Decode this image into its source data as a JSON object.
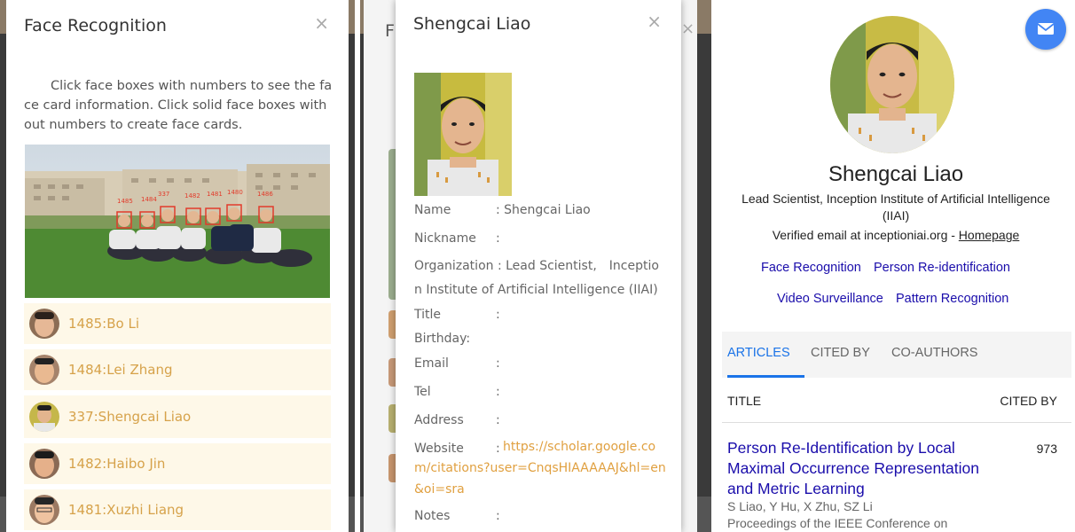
{
  "panel1": {
    "title": "Face Recognition",
    "close": "×",
    "instructions": "Click face boxes with numbers to see the face card information. Click solid face boxes without numbers to create face cards.",
    "faces": [
      {
        "label": "1485:Bo Li"
      },
      {
        "label": "1484:Lei Zhang"
      },
      {
        "label": "337:Shengcai Liao"
      },
      {
        "label": "1482:Haibo Jin"
      },
      {
        "label": "1481:Xuzhi Liang"
      }
    ]
  },
  "panel2": {
    "behind_title_letter": "F",
    "behind_close": "×",
    "title": "Shengcai Liao",
    "close": "×",
    "fields": {
      "name_label": "Name",
      "name_value": ": Shengcai Liao",
      "nickname_label": "Nickname",
      "nickname_value": ":",
      "org_text": "Organization : Lead Scientist,　Inception Institute of Artificial Intelligence (IIAI)",
      "title_label": "Title",
      "title_value": ":",
      "birthday_label": "Birthday:",
      "email_label": "Email",
      "email_value": ":",
      "tel_label": "Tel",
      "tel_value": ":",
      "address_label": "Address",
      "address_value": ":",
      "website_label": "Website",
      "website_colon": ":",
      "website_url": "https://scholar.google.com/citations?user=CnqsHIAAAAAJ&hl=en&oi=sra",
      "notes_label": "Notes",
      "notes_value": ":"
    }
  },
  "panel3": {
    "name": "Shengcai Liao",
    "affiliation": "Lead Scientist, Inception Institute of Artificial Intelligence (IIAI)",
    "email_text": "Verified email at inceptioniai.org - ",
    "homepage": "Homepage",
    "interests": [
      "Face Recognition",
      "Person Re-identification",
      "Video Surveillance",
      "Pattern Recognition"
    ],
    "tabs": [
      "ARTICLES",
      "CITED BY",
      "CO-AUTHORS"
    ],
    "col_title": "TITLE",
    "col_cited": "CITED BY",
    "article": {
      "title": "Person Re-Identification by Local Maximal Occurrence Representation and Metric Learning",
      "cited_by": "973",
      "authors": "S Liao, Y Hu, X Zhu, SZ Li",
      "venue": "Proceedings of the IEEE Conference on"
    }
  }
}
